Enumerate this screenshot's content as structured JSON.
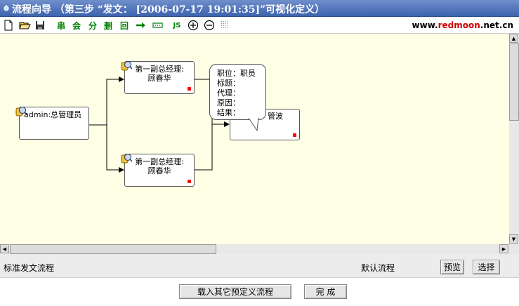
{
  "window": {
    "title": "流程向导 （第三步 “发文： [2006-07-17 19:01:35]”可视化定义）"
  },
  "toolbar": {
    "icons": [
      "new-file-icon",
      "open-folder-icon",
      "save-disk-icon"
    ],
    "chars": {
      "serial": "串",
      "join": "会",
      "split": "分",
      "delete": "删",
      "back": "回"
    },
    "js": "JS",
    "brand_prefix": "www.",
    "brand_red": "redmoon",
    "brand_suffix": ".net.cn",
    "colors": {
      "green": "#008000",
      "brand_red": "#d00000"
    }
  },
  "flow": {
    "start_node": {
      "label": "admin:总管理员"
    },
    "upper_node": {
      "line1": "第一副总经理:",
      "line2": "顾春华"
    },
    "lower_node": {
      "line1": "第一副总经理:",
      "line2": "顾春华"
    },
    "end_node": {
      "label": "管波"
    },
    "tooltip": {
      "position": "职位：职员",
      "title": "标题：",
      "agent": "代理：",
      "reason": "原因：",
      "result": "结果："
    }
  },
  "status": {
    "flow_name": "标准发文流程",
    "default_flow": "默认流程",
    "preview_button": "预览",
    "select_button": "选择"
  },
  "footer": {
    "load_button": "载入其它预定义流程",
    "finish_button": "完 成"
  }
}
